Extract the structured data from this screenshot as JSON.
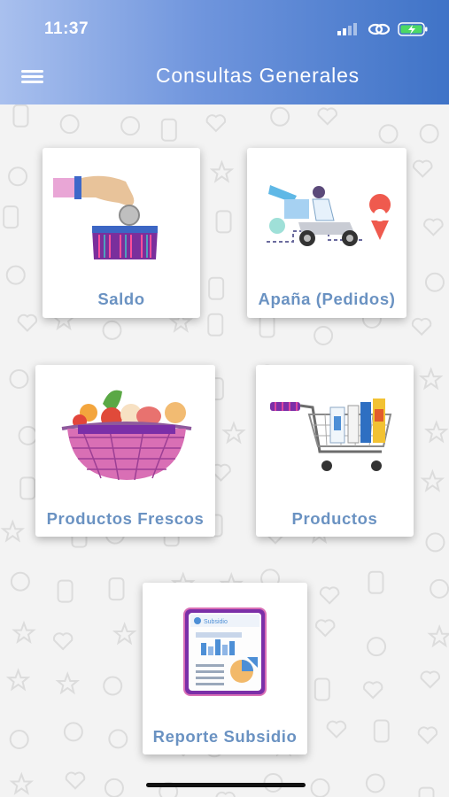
{
  "status_bar": {
    "time": "11:37"
  },
  "header": {
    "title": "Consultas Generales",
    "menu_icon": "hamburger-menu-icon"
  },
  "colors": {
    "header_start": "#a9c0ee",
    "header_end": "#3f73c7",
    "card_label": "#6a92c2"
  },
  "cards": [
    {
      "label": "Saldo",
      "icon": "coin-purse-icon"
    },
    {
      "label": "Apaña (Pedidos)",
      "icon": "delivery-scooter-icon"
    },
    {
      "label": "Productos Frescos",
      "icon": "produce-basket-icon"
    },
    {
      "label": "Productos",
      "icon": "shopping-cart-icon"
    },
    {
      "label": "Reporte Subsidio",
      "icon": "report-document-icon"
    }
  ],
  "report_header_text": "Subsidio"
}
